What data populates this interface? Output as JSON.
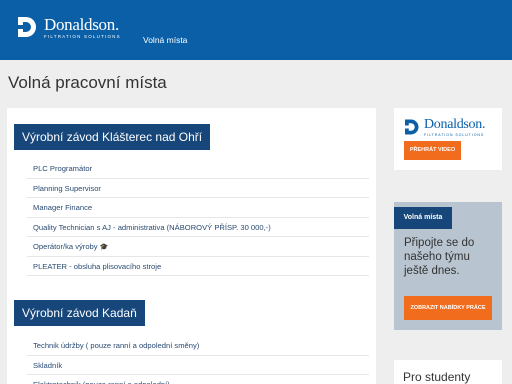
{
  "header": {
    "logo_name": "Donaldson.",
    "logo_tagline": "FILTRATION SOLUTIONS",
    "nav_label": "Volná místa"
  },
  "page_title": "Volná pracovní místa",
  "sections": [
    {
      "title": "Výrobní závod Klášterec nad Ohří",
      "jobs": [
        "PLC Programátor",
        "Planning Supervisor",
        "Manager Finance",
        "Quality Technician s AJ - administrativa (NÁBOROVÝ PŘÍSP. 30 000,-)",
        "Operátor/ka výroby",
        "PLEATER - obsluha plisovacího stroje"
      ],
      "job_badge_icon": "graduation-cap-icon"
    },
    {
      "title": "Výrobní závod Kadaň",
      "jobs": [
        "Technik údržby ( pouze ranní a odpolední směny)",
        "Skladník",
        "Elektrotechnik (pouze ranní a odpolední)"
      ]
    }
  ],
  "sidebar": {
    "video_card": {
      "logo_name": "Donaldson.",
      "logo_tagline": "FILTRATION SOLUTIONS",
      "button_label": "PŘEHRÁT VIDEO"
    },
    "jobs_card": {
      "tag": "Volná místa",
      "text": "Připojte se do našeho týmu ještě dnes.",
      "button_label": "ZOBRAZIT NABÍDKY PRÁCE"
    },
    "students_card": {
      "title": "Pro studenty"
    }
  },
  "colors": {
    "header_blue": "#0a5fa7",
    "section_navy": "#16467a",
    "accent_orange": "#f26c1d",
    "page_bg": "#eeeeee",
    "link_blue": "#2a4b73"
  }
}
